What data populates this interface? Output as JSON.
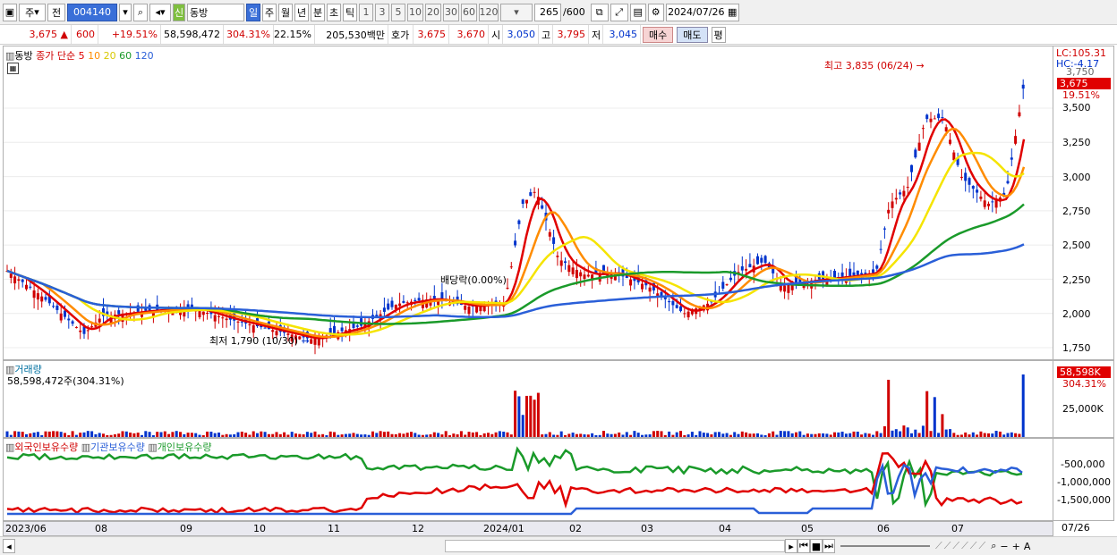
{
  "toolbar": {
    "period": "주",
    "prev": "전",
    "code": "004140",
    "sin": "신",
    "name": "동방",
    "tabs": [
      "일",
      "주",
      "월",
      "년",
      "분",
      "초",
      "틱"
    ],
    "nums": [
      "1",
      "3",
      "5",
      "10",
      "20",
      "30",
      "60",
      "120"
    ],
    "count": "265",
    "total": "/600",
    "date": "2024/07/26"
  },
  "quote": {
    "price": "3,675",
    "change": "600",
    "rate": "+19.51%",
    "volume": "58,598,472",
    "volrate": "304.31%",
    "turnover": "22.15%",
    "amount": "205,530백만",
    "hoga_label": "호가",
    "hoga1": "3,675",
    "hoga2": "3,670",
    "open_label": "시",
    "open": "3,050",
    "high_label": "고",
    "high": "3,795",
    "low_label": "저",
    "low": "3,045",
    "buy": "매수",
    "sell": "매도",
    "eval": "평"
  },
  "chart": {
    "title": "동방",
    "legend_prefix": "종가 단순",
    "ma_periods": [
      "5",
      "10",
      "20",
      "60",
      "120"
    ],
    "max_note": "최고 3,835 (06/24)",
    "min_note": "최저 1,790 (10/30)",
    "div_note": "배당락(0.00%)",
    "lc": "LC:105.31",
    "hc": "HC:-4.17",
    "price_tag": "3,675",
    "rate_tag": "19.51%",
    "yticks": [
      "3,750",
      "3,500",
      "3,250",
      "3,000",
      "2,750",
      "2,500",
      "2,250",
      "2,000",
      "1,750"
    ]
  },
  "volume": {
    "title": "거래량",
    "value": "58,598,472주(304.31%)",
    "tag": "58,598K",
    "rate": "304.31%",
    "tick": "25,000K"
  },
  "holding": {
    "s1": "외국인보유수량",
    "s2": "기관보유수량",
    "s3": "개인보유수량",
    "ticks": [
      "-500,000",
      "-1,000,000",
      "-1,500,000"
    ]
  },
  "dates": {
    "labels": [
      "2023/06",
      "08",
      "09",
      "10",
      "11",
      "12",
      "2024/01",
      "02",
      "03",
      "04",
      "05",
      "06",
      "07"
    ],
    "last": "07/26"
  },
  "colors": {
    "up": "#d00000",
    "down": "#0033cc",
    "ma5": "#e00000",
    "ma10": "#ff8c00",
    "ma20": "#f5e400",
    "ma60": "#1a9a2a",
    "ma120": "#2a5fd8"
  }
}
